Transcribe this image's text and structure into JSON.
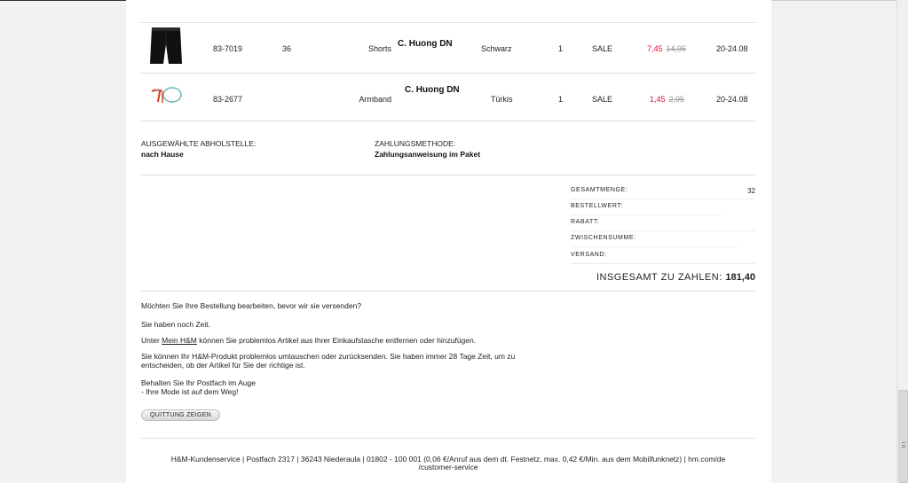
{
  "order_items": [
    {
      "article": "83-7019",
      "size": "36",
      "type": "Shorts",
      "seller": "C. Huong DN",
      "color": "Schwarz",
      "qty": "1",
      "status": "SALE",
      "price_new": "7,45",
      "price_old": "14,95",
      "delivery": "20-24.08",
      "image_icon": "black-shorts-image"
    },
    {
      "article": "83-2677",
      "size": "",
      "type": "Armband",
      "seller": "C. Huong DN",
      "color": "Türkis",
      "qty": "1",
      "status": "SALE",
      "price_new": "1,45",
      "price_old": "2,95",
      "delivery": "20-24.08",
      "image_icon": "bracelet-image"
    }
  ],
  "pickup": {
    "label": "AUSGEWÄHLTE ABHOLSTELLE:",
    "value": "nach Hause"
  },
  "payment": {
    "label": "ZAHLUNGSMETHODE:",
    "value": "Zahlungsanweisung im Paket"
  },
  "summary": {
    "total_qty_label": "GESAMTMENGE:",
    "total_qty_value": "32",
    "order_value_label": "BESTELLWERT:",
    "discount_label": "RABATT:",
    "subtotal_label": "ZWISCHENSUMME:",
    "shipping_label": "VERSAND:",
    "grand_total_label": "INSGESAMT ZU ZAHLEN:",
    "grand_total_value": "181,40"
  },
  "messages": {
    "edit_question": "Möchten Sie Ihre Bestellung bearbeiten, bevor wir sie versenden?",
    "time_left": "Sie haben noch Zeit.",
    "under_prefix": "Unter",
    "my_hm_link": "Mein H&M",
    "under_suffix": "können Sie problemlos Artikel aus Ihrer Einkaufstasche entfernen oder hinzufügen.",
    "return_info": "Sie können Ihr H&M-Produkt problemlos umtauschen oder zurücksenden. Sie haben immer 28 Tage Zeit, um zu entscheiden, ob der Artikel für Sie der richtige ist.",
    "closing_line1": "Behalten Sie Ihr Postfach im Auge",
    "closing_line2": "- Ihre Mode ist auf dem Weg!"
  },
  "receipt_button": "QUITTUNG ZEIGEN",
  "footer": {
    "line1": "H&M-Kundenservice | Postfach 2317 | 36243 Niederaula | 01802 - 100 001 (0,06 €/Anruf aus dem dt. Festnetz, max. 0,42 €/Min. aus dem Mobilfunknetz) | hm.com/de",
    "line2": "/customer-service"
  }
}
